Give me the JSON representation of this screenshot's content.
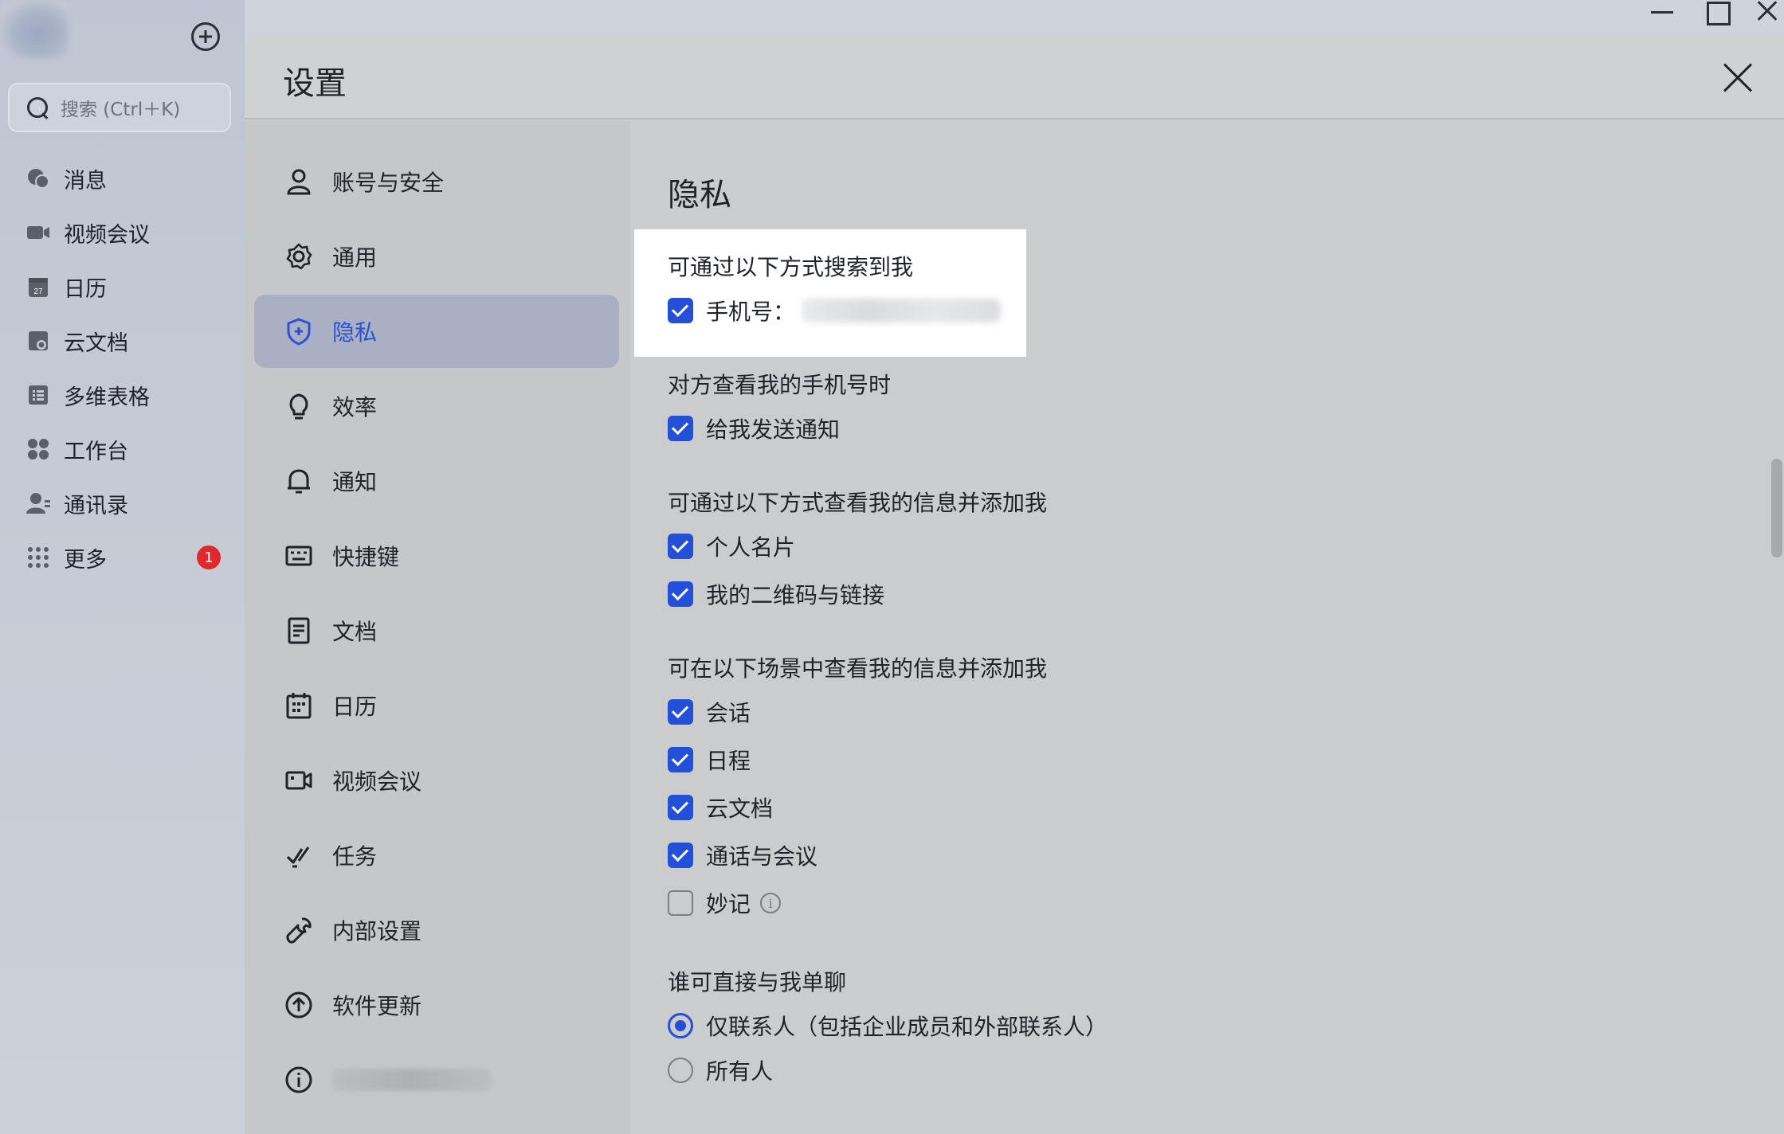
{
  "sidebar": {
    "search_placeholder": "搜索 (Ctrl＋K)",
    "items": [
      {
        "label": "消息",
        "icon": "chat-icon"
      },
      {
        "label": "视频会议",
        "icon": "video-icon"
      },
      {
        "label": "日历",
        "icon": "calendar-icon"
      },
      {
        "label": "云文档",
        "icon": "cloud-doc-icon"
      },
      {
        "label": "多维表格",
        "icon": "table-icon"
      },
      {
        "label": "工作台",
        "icon": "workspace-icon"
      },
      {
        "label": "通讯录",
        "icon": "contacts-icon"
      },
      {
        "label": "更多",
        "icon": "more-icon",
        "badge": "1"
      }
    ]
  },
  "modal": {
    "title": "设置",
    "nav": [
      {
        "label": "账号与安全",
        "icon": "user-icon"
      },
      {
        "label": "通用",
        "icon": "gear-icon"
      },
      {
        "label": "隐私",
        "icon": "shield-icon",
        "active": true
      },
      {
        "label": "效率",
        "icon": "bulb-icon"
      },
      {
        "label": "通知",
        "icon": "bell-icon"
      },
      {
        "label": "快捷键",
        "icon": "keyboard-icon"
      },
      {
        "label": "文档",
        "icon": "document-icon"
      },
      {
        "label": "日历",
        "icon": "calendar-icon"
      },
      {
        "label": "视频会议",
        "icon": "video-icon"
      },
      {
        "label": "任务",
        "icon": "task-icon"
      },
      {
        "label": "内部设置",
        "icon": "wrench-icon"
      },
      {
        "label": "软件更新",
        "icon": "update-icon"
      },
      {
        "label": "",
        "icon": "info-icon"
      }
    ]
  },
  "privacy": {
    "title": "隐私",
    "search_group": {
      "label": "可通过以下方式搜索到我",
      "phone_label": "手机号："
    },
    "view_phone_group": {
      "label": "对方查看我的手机号时",
      "notify_label": "给我发送通知"
    },
    "add_me_group": {
      "label": "可通过以下方式查看我的信息并添加我",
      "options": [
        "个人名片",
        "我的二维码与链接"
      ]
    },
    "scene_group": {
      "label": "可在以下场景中查看我的信息并添加我",
      "options": [
        {
          "label": "会话",
          "checked": true
        },
        {
          "label": "日程",
          "checked": true
        },
        {
          "label": "云文档",
          "checked": true
        },
        {
          "label": "通话与会议",
          "checked": true
        },
        {
          "label": "妙记",
          "checked": false
        }
      ]
    },
    "chat_group": {
      "label": "谁可直接与我单聊",
      "options": [
        {
          "label": "仅联系人（包括企业成员和外部联系人）",
          "selected": true
        },
        {
          "label": "所有人",
          "selected": false
        }
      ]
    }
  }
}
